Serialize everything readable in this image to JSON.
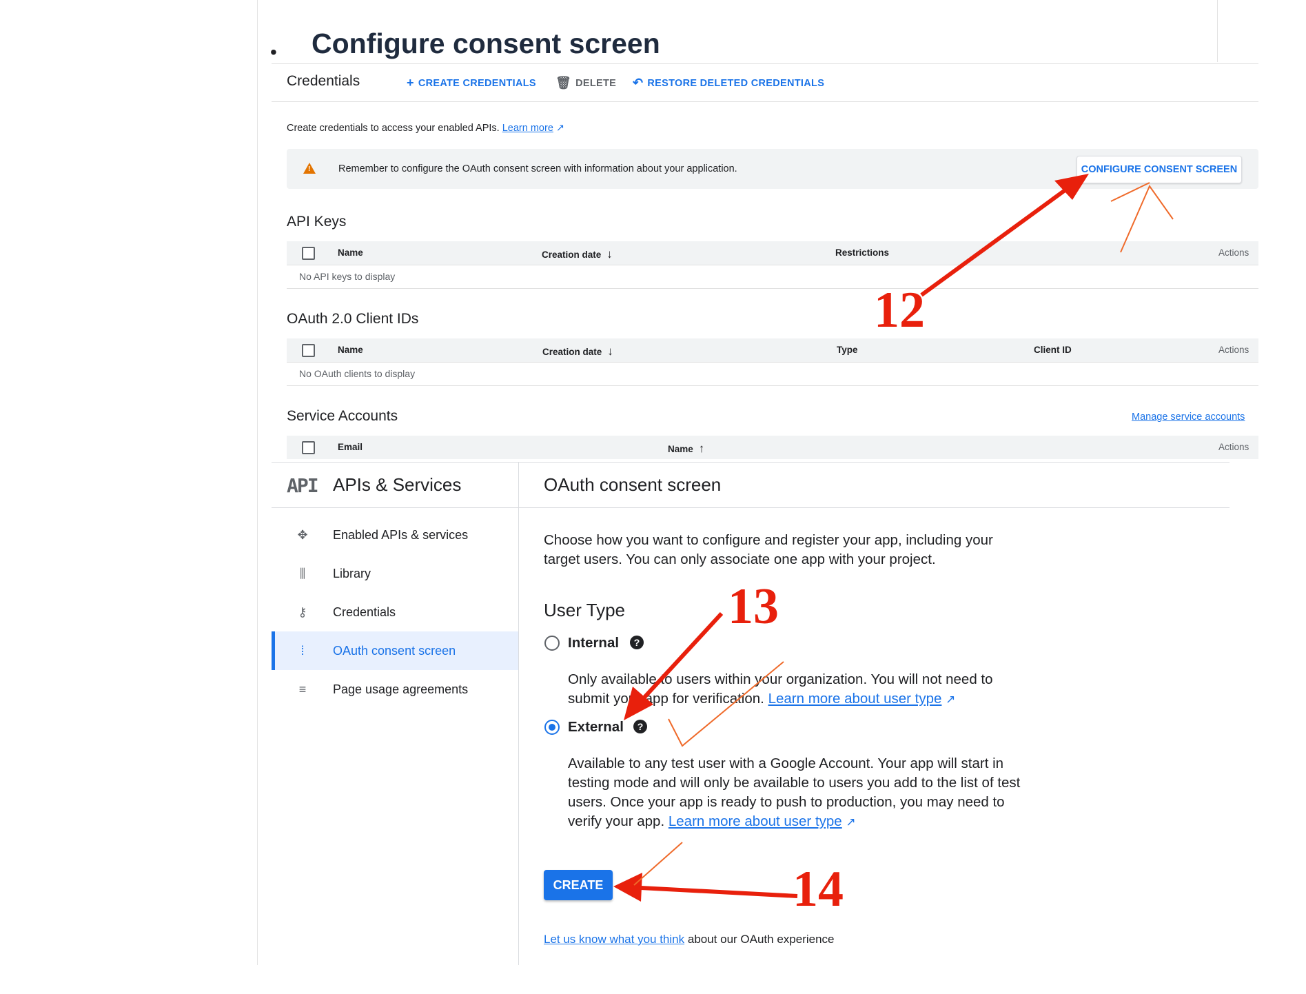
{
  "heading": {
    "bullet": "•",
    "text": "Configure consent screen"
  },
  "credentials": {
    "title": "Credentials",
    "toolbar": {
      "create": "CREATE CREDENTIALS",
      "delete": "DELETE",
      "restore": "RESTORE DELETED CREDENTIALS"
    },
    "description": "Create credentials to access your enabled APIs.",
    "learn_more": "Learn more",
    "banner": {
      "text": "Remember to configure the OAuth consent screen with information about your application.",
      "button": "CONFIGURE CONSENT SCREEN"
    },
    "api_keys": {
      "title": "API Keys",
      "columns": [
        "Name",
        "Creation date",
        "Restrictions",
        "Actions"
      ],
      "empty": "No API keys to display"
    },
    "oauth_clients": {
      "title": "OAuth 2.0 Client IDs",
      "columns": [
        "Name",
        "Creation date",
        "Type",
        "Client ID",
        "Actions"
      ],
      "empty": "No OAuth clients to display"
    },
    "service_accounts": {
      "title": "Service Accounts",
      "manage_link": "Manage service accounts",
      "columns": [
        "Email",
        "Name",
        "Actions"
      ]
    }
  },
  "sidebar": {
    "logo": "API",
    "title": "APIs & Services",
    "items": [
      {
        "label": "Enabled APIs & services",
        "icon": "enabled-apis-icon"
      },
      {
        "label": "Library",
        "icon": "library-icon"
      },
      {
        "label": "Credentials",
        "icon": "key-icon"
      },
      {
        "label": "OAuth consent screen",
        "icon": "consent-icon",
        "active": true
      },
      {
        "label": "Page usage agreements",
        "icon": "settings-list-icon"
      }
    ]
  },
  "oauth": {
    "title": "OAuth consent screen",
    "intro_line1": "Choose how you want to configure and register your app, including your",
    "intro_line2": "target users. You can only associate one app with your project.",
    "user_type_title": "User Type",
    "internal": {
      "label": "Internal",
      "desc_line1": "Only available to users within your organization. You will not need to",
      "desc_line2": "submit your app for verification.",
      "link": "Learn more about user type"
    },
    "external": {
      "label": "External",
      "selected": true,
      "desc_line1": "Available to any test user with a Google Account. Your app will start in",
      "desc_line2": "testing mode and will only be available to users you add to the list of test",
      "desc_line3": "users. Once your app is ready to push to production, you may need to",
      "desc_line4": "verify your app.",
      "link": "Learn more about user type"
    },
    "create_button": "CREATE",
    "feedback_link": "Let us know what you think",
    "feedback_text": "about our OAuth experience"
  },
  "annotations": {
    "step12": "12",
    "step13": "13",
    "step14": "14"
  },
  "colors": {
    "accent": "#1a73e8",
    "annotation": "#e8200c",
    "warning": "#e37400"
  }
}
